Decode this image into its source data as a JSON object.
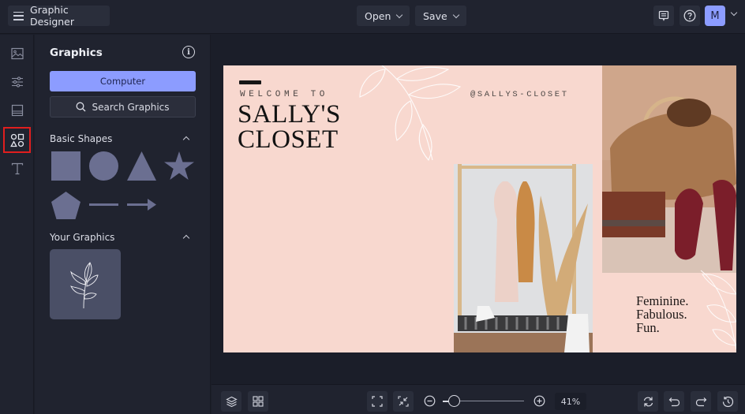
{
  "app": {
    "title": "Graphic Designer"
  },
  "toolbar": {
    "open_label": "Open",
    "save_label": "Save",
    "icons": [
      "comment-icon",
      "help-icon"
    ],
    "avatar_initial": "M"
  },
  "rail": {
    "items": [
      {
        "name": "images",
        "icon": "image-icon",
        "active": false
      },
      {
        "name": "adjustments",
        "icon": "sliders-icon",
        "active": false
      },
      {
        "name": "layouts",
        "icon": "layout-icon",
        "active": false
      },
      {
        "name": "graphics",
        "icon": "shapes-icon",
        "active": true
      },
      {
        "name": "text",
        "icon": "text-icon",
        "active": false
      }
    ]
  },
  "panel": {
    "title": "Graphics",
    "computer_label": "Computer",
    "search_label": "Search Graphics",
    "basic_shapes": {
      "heading": "Basic Shapes",
      "shapes": [
        "square",
        "circle",
        "triangle",
        "star",
        "pentagon",
        "line",
        "arrow"
      ]
    },
    "your_graphics": {
      "heading": "Your Graphics",
      "items": [
        "leaf-branch"
      ]
    },
    "colors": {
      "shape_fill": "#6b6f91",
      "accent": "#8c9cff"
    }
  },
  "canvas": {
    "welcome": "WELCOME TO",
    "title_line1": "SALLY'S",
    "title_line2": "CLOSET",
    "handle": "@SALLYS-CLOSET",
    "tagline_1": "Feminine.",
    "tagline_2": "Fabulous.",
    "tagline_3": "Fun.",
    "background": "#f8d8cf",
    "images": [
      "clothing-rack-photo",
      "wicker-bag-shoes-photo"
    ]
  },
  "bottombar": {
    "zoom_percent": "41%",
    "zoom_value": 0.1
  }
}
